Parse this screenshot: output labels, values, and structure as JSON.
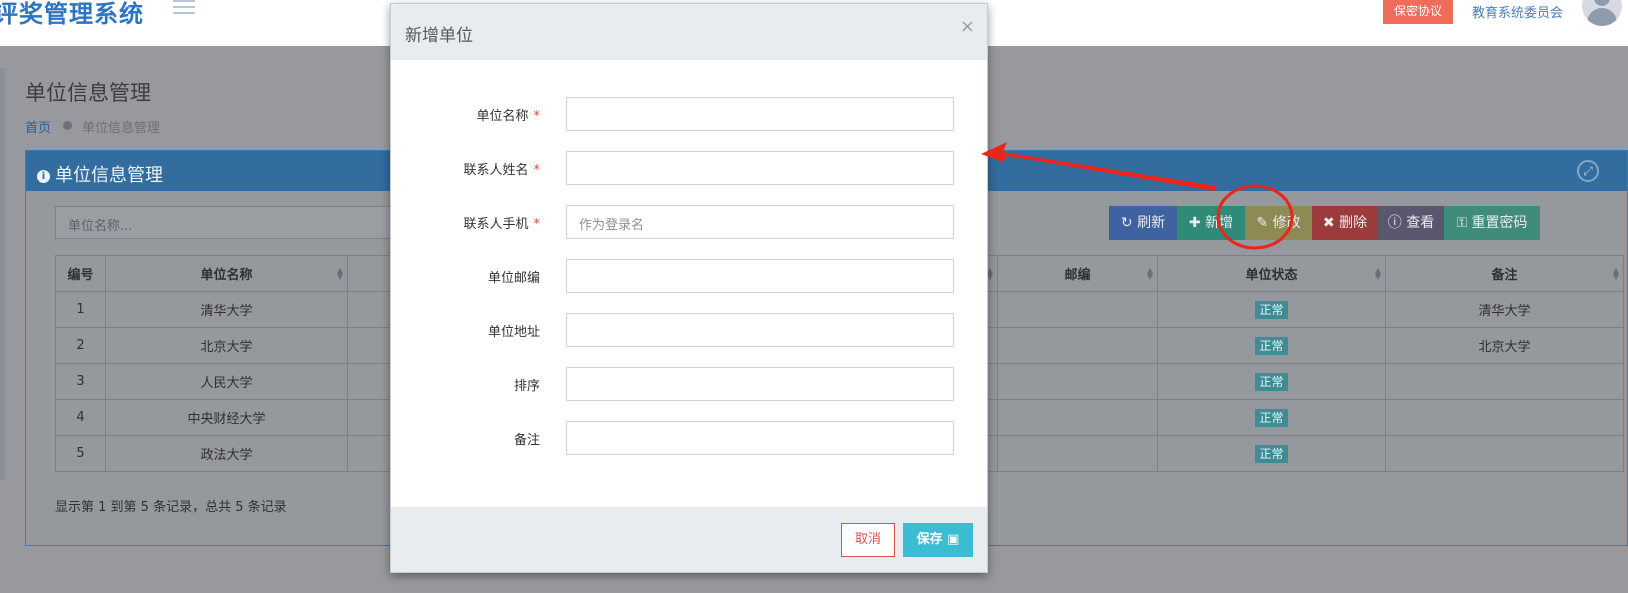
{
  "app": {
    "brand": "评奖管理系统",
    "secret_btn": "保密协议",
    "org_name": "教育系统委员会"
  },
  "page": {
    "title": "单位信息管理",
    "crumb_home": "首页",
    "crumb_current": "单位信息管理"
  },
  "panel": {
    "title": "单位信息管理",
    "search_placeholder": "单位名称..."
  },
  "toolbar": {
    "refresh": "刷新",
    "add": "新增",
    "edit": "修改",
    "delete": "删除",
    "view": "查看",
    "reset": "重置密码",
    "colors": {
      "refresh": "#3f62a0",
      "add": "#2f8a78",
      "edit": "#8d8a55",
      "delete": "#9b3b3b",
      "view": "#5b5670",
      "reset": "#3f8c7c"
    }
  },
  "table": {
    "headers": [
      "编号",
      "单位名称",
      "",
      "",
      "邮编",
      "单位状态",
      "备注"
    ],
    "rows": [
      {
        "id": "1",
        "name": "清华大学",
        "status": "正常",
        "note": "清华大学"
      },
      {
        "id": "2",
        "name": "北京大学",
        "status": "正常",
        "note": "北京大学"
      },
      {
        "id": "3",
        "name": "人民大学",
        "status": "正常",
        "note": ""
      },
      {
        "id": "4",
        "name": "中央财经大学",
        "status": "正常",
        "note": ""
      },
      {
        "id": "5",
        "name": "政法大学",
        "status": "正常",
        "note": ""
      }
    ],
    "footer": "显示第 1 到第 5 条记录，总共 5 条记录"
  },
  "modal": {
    "title": "新增单位",
    "close": "×",
    "fields": [
      {
        "label": "单位名称",
        "required": "*",
        "value": "",
        "placeholder": ""
      },
      {
        "label": "联系人姓名",
        "required": "*",
        "value": "",
        "placeholder": ""
      },
      {
        "label": "联系人手机",
        "required": "*",
        "value": "",
        "placeholder": "作为登录名"
      },
      {
        "label": "单位邮编",
        "required": "",
        "value": "",
        "placeholder": ""
      },
      {
        "label": "单位地址",
        "required": "",
        "value": "",
        "placeholder": ""
      },
      {
        "label": "排序",
        "required": "",
        "value": "",
        "placeholder": ""
      },
      {
        "label": "备注",
        "required": "",
        "value": "",
        "placeholder": ""
      }
    ],
    "cancel": "取消",
    "save": "保存"
  },
  "annotation": {
    "color": "#e8261c"
  }
}
